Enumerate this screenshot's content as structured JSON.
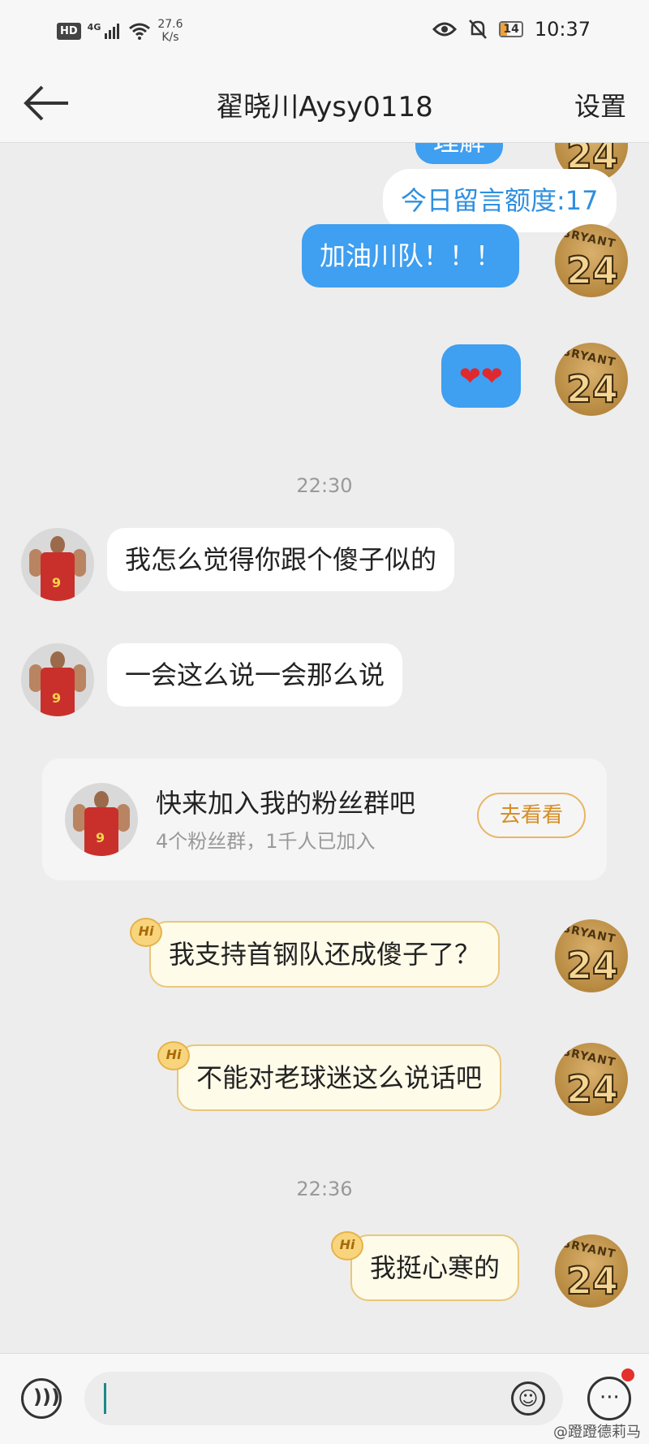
{
  "status_bar": {
    "hd": "HD",
    "network": "4G",
    "speed_value": "27.6",
    "speed_unit": "K/s",
    "battery": "14",
    "time": "10:37"
  },
  "nav": {
    "title": "翟晓川Aysy0118",
    "settings_label": "设置"
  },
  "messages": {
    "partial_top": "理解",
    "quota_notice": "今日留言额度:17",
    "m1": "加油川队！！！",
    "m2": "❤❤",
    "ts1": "22:30",
    "m3": "我怎么觉得你跟个傻子似的",
    "m4": "一会这么说一会那么说",
    "m5": "我支持首钢队还成傻子了？",
    "m6": "不能对老球迷这么说话吧",
    "ts2": "22:36",
    "m7": "我挺心寒的"
  },
  "kobe_avatar": {
    "brand": "BRYANT",
    "number": "24"
  },
  "player_avatar": {
    "number": "9"
  },
  "hi_badge": "Hi",
  "fan_card": {
    "title": "快来加入我的粉丝群吧",
    "subtitle": "4个粉丝群，1千人已加入",
    "button": "去看看"
  },
  "watermark": "@蹬蹬德莉马",
  "colors": {
    "blue_bubble": "#3f9ff0",
    "cream_bubble": "#fffbe9",
    "accent_orange": "#d68e25"
  }
}
